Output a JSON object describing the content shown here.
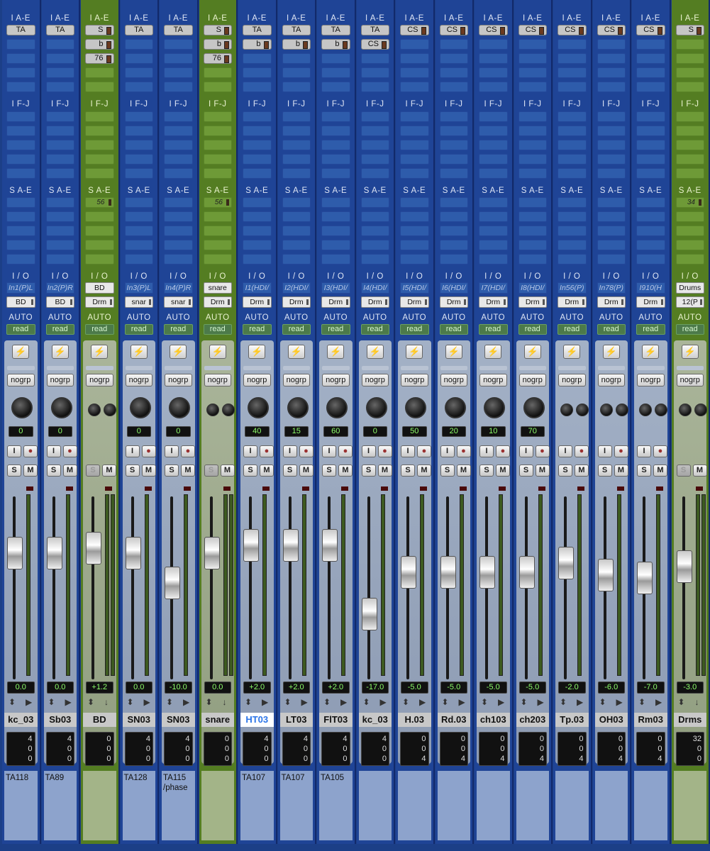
{
  "headers": {
    "inserts_ae": "I A-E",
    "inserts_fj": "I F-J",
    "sends_ae": "S A-E",
    "io": "I / O",
    "auto": "AUTO"
  },
  "strips": [
    {
      "name": "kc_03",
      "kind": "aud",
      "inserts": [
        "TA"
      ],
      "sends": [],
      "io_in": "In1(P)L",
      "io_out": "BD",
      "auto": "read",
      "group": "nogrp",
      "pan": [
        "0"
      ],
      "vol": "0.0",
      "counts": [
        "4",
        "0",
        "0"
      ],
      "comment": "TA118",
      "fader": 0.73
    },
    {
      "name": "Sb03",
      "kind": "aud",
      "inserts": [
        "TA"
      ],
      "sends": [],
      "io_in": "In2(P)R",
      "io_out": "BD",
      "auto": "read",
      "group": "nogrp",
      "pan": [
        "0"
      ],
      "vol": "0.0",
      "counts": [
        "4",
        "0",
        "0"
      ],
      "comment": "TA89",
      "fader": 0.73
    },
    {
      "name": "BD",
      "kind": "aux",
      "inserts": [],
      "plugs": [
        "S",
        "b",
        "76"
      ],
      "sends": [
        "56"
      ],
      "io_in": "BD",
      "io_out": "Drm",
      "auto": "read",
      "group": "nogrp",
      "pan": [],
      "vol": "+1.2",
      "counts": [
        "0",
        "0",
        "0"
      ],
      "comment": "",
      "fader": 0.76
    },
    {
      "name": "SN03",
      "kind": "aud",
      "inserts": [
        "TA"
      ],
      "sends": [],
      "io_in": "In3(P)L",
      "io_out": "snar",
      "auto": "read",
      "group": "nogrp",
      "pan": [
        "0"
      ],
      "vol": "0.0",
      "counts": [
        "4",
        "0",
        "0"
      ],
      "comment": "TA128",
      "fader": 0.73
    },
    {
      "name": "SN03",
      "kind": "aud",
      "inserts": [
        "TA"
      ],
      "sends": [],
      "io_in": "In4(P)R",
      "io_out": "snar",
      "auto": "read",
      "group": "nogrp",
      "pan": [
        "0"
      ],
      "vol": "-10.0",
      "counts": [
        "4",
        "0",
        "0"
      ],
      "comment": "TA115 /phase",
      "fader": 0.53
    },
    {
      "name": "snare",
      "kind": "aux",
      "inserts": [],
      "plugs": [
        "S",
        "b",
        "76"
      ],
      "sends": [
        "56"
      ],
      "io_in": "snare",
      "io_out": "Drm",
      "auto": "read",
      "group": "nogrp",
      "pan": [],
      "vol": "0.0",
      "counts": [
        "0",
        "0",
        "0"
      ],
      "comment": "",
      "fader": 0.73
    },
    {
      "name": "HT03",
      "kind": "aud",
      "inserts": [
        "TA"
      ],
      "plugs": [
        "b"
      ],
      "sends": [],
      "io_in": "I1(HDI/",
      "io_out": "Drm",
      "auto": "read",
      "group": "nogrp",
      "pan": [
        "40"
      ],
      "vol": "+2.0",
      "counts": [
        "4",
        "0",
        "0"
      ],
      "comment": "TA107",
      "fader": 0.78,
      "selected": true
    },
    {
      "name": "LT03",
      "kind": "aud",
      "inserts": [
        "TA"
      ],
      "plugs": [
        "b"
      ],
      "sends": [],
      "io_in": "I2(HDI/",
      "io_out": "Drm",
      "auto": "read",
      "group": "nogrp",
      "pan": [
        "15"
      ],
      "vol": "+2.0",
      "counts": [
        "4",
        "0",
        "0"
      ],
      "comment": "TA107",
      "fader": 0.78
    },
    {
      "name": "FlT03",
      "kind": "aud",
      "inserts": [
        "TA"
      ],
      "plugs": [
        "b"
      ],
      "sends": [],
      "io_in": "I3(HDI/",
      "io_out": "Drm",
      "auto": "read",
      "group": "nogrp",
      "pan": [
        "60"
      ],
      "vol": "+2.0",
      "counts": [
        "4",
        "0",
        "0"
      ],
      "comment": "TA105",
      "fader": 0.78
    },
    {
      "name": "kc_03",
      "kind": "aud",
      "inserts": [
        "TA"
      ],
      "plugs": [
        "CS"
      ],
      "sends": [],
      "io_in": "I4(HDI/",
      "io_out": "Drm",
      "auto": "read",
      "group": "nogrp",
      "pan": [
        "0"
      ],
      "vol": "-17.0",
      "counts": [
        "4",
        "0",
        "0"
      ],
      "comment": "",
      "fader": 0.32
    },
    {
      "name": "H.03",
      "kind": "aud",
      "inserts": [],
      "plugs": [
        "CS"
      ],
      "sends": [],
      "io_in": "I5(HDI/",
      "io_out": "Drm",
      "auto": "read",
      "group": "nogrp",
      "pan": [
        "50"
      ],
      "vol": "-5.0",
      "counts": [
        "0",
        "0",
        "4"
      ],
      "comment": "",
      "fader": 0.6
    },
    {
      "name": "Rd.03",
      "kind": "aud",
      "inserts": [],
      "plugs": [
        "CS"
      ],
      "sends": [],
      "io_in": "I6(HDI/",
      "io_out": "Drm",
      "auto": "read",
      "group": "nogrp",
      "pan": [
        "20"
      ],
      "vol": "-5.0",
      "counts": [
        "0",
        "0",
        "4"
      ],
      "comment": "",
      "fader": 0.6
    },
    {
      "name": "ch103",
      "kind": "aud",
      "inserts": [],
      "plugs": [
        "CS"
      ],
      "sends": [],
      "io_in": "I7(HDI/",
      "io_out": "Drm",
      "auto": "read",
      "group": "nogrp",
      "pan": [
        "10"
      ],
      "vol": "-5.0",
      "counts": [
        "0",
        "0",
        "4"
      ],
      "comment": "",
      "fader": 0.6
    },
    {
      "name": "ch203",
      "kind": "aud",
      "inserts": [],
      "plugs": [
        "CS"
      ],
      "sends": [],
      "io_in": "I8(HDI/",
      "io_out": "Drm",
      "auto": "read",
      "group": "nogrp",
      "pan": [
        "70"
      ],
      "vol": "-5.0",
      "counts": [
        "0",
        "0",
        "4"
      ],
      "comment": "",
      "fader": 0.6
    },
    {
      "name": "Tp.03",
      "kind": "aud",
      "inserts": [],
      "plugs": [
        "CS"
      ],
      "sends": [],
      "io_in": "In56(P)",
      "io_out": "Drm",
      "auto": "read",
      "group": "nogrp",
      "pan": [],
      "vol": "-2.0",
      "counts": [
        "0",
        "0",
        "4"
      ],
      "comment": "",
      "fader": 0.66
    },
    {
      "name": "OH03",
      "kind": "aud",
      "inserts": [],
      "plugs": [
        "CS"
      ],
      "sends": [],
      "io_in": "In78(P)",
      "io_out": "Drm",
      "auto": "read",
      "group": "nogrp",
      "pan": [],
      "vol": "-6.0",
      "counts": [
        "0",
        "0",
        "4"
      ],
      "comment": "",
      "fader": 0.58
    },
    {
      "name": "Rm03",
      "kind": "aud",
      "inserts": [],
      "plugs": [
        "CS"
      ],
      "sends": [],
      "io_in": "I910(H",
      "io_out": "Drm",
      "auto": "read",
      "group": "nogrp",
      "pan": [],
      "vol": "-7.0",
      "counts": [
        "0",
        "0",
        "4"
      ],
      "comment": "",
      "fader": 0.56
    },
    {
      "name": "Drms",
      "kind": "aux",
      "inserts": [],
      "plugs": [
        "S"
      ],
      "sends": [
        "34"
      ],
      "io_in": "Drums",
      "io_out": "12(P",
      "auto": "read",
      "group": "nogrp",
      "pan": [],
      "vol": "-3.0",
      "counts": [
        "32",
        "0",
        "0"
      ],
      "comment": "",
      "fader": 0.64
    }
  ]
}
